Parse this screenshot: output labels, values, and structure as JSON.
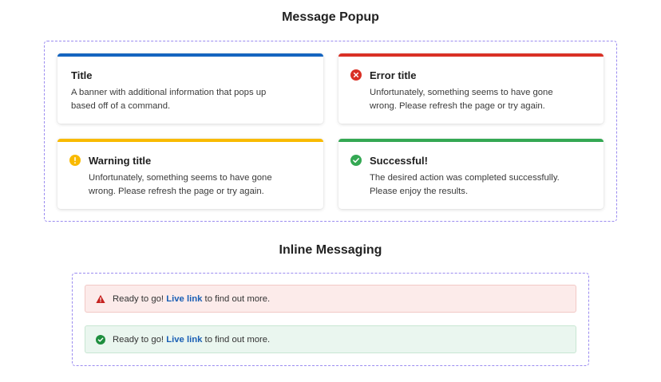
{
  "sections": {
    "popup_title": "Message Popup",
    "inline_title": "Inline Messaging"
  },
  "colors": {
    "info": "#1565c0",
    "error": "#d93025",
    "warning": "#f9ba00",
    "success": "#34a853",
    "link": "#1a5fb4",
    "dashed_border": "#9b8cf0"
  },
  "popups": {
    "info": {
      "title": "Title",
      "body_line1": "A banner with additional information that pops up",
      "body_line2": "based off of a command."
    },
    "error": {
      "icon": "x-circle-icon",
      "title": "Error title",
      "body_line1": "Unfortunately, something seems to have gone",
      "body_line2": "wrong. Please refresh the page or try again."
    },
    "warning": {
      "icon": "exclamation-circle-icon",
      "title": "Warning title",
      "body_line1": "Unfortunately, something seems to have gone",
      "body_line2": "wrong. Please refresh the page or try again."
    },
    "success": {
      "icon": "check-circle-icon",
      "title": "Successful!",
      "body_line1": "The desired action was completed successfully.",
      "body_line2": "Please enjoy the results."
    }
  },
  "inline": {
    "error": {
      "icon": "warning-triangle-icon",
      "prefix": "Ready to go! ",
      "link": "Live link",
      "suffix": " to find out more."
    },
    "success": {
      "icon": "check-circle-icon",
      "prefix": "Ready to go! ",
      "link": "Live link",
      "suffix": " to find out more."
    }
  }
}
